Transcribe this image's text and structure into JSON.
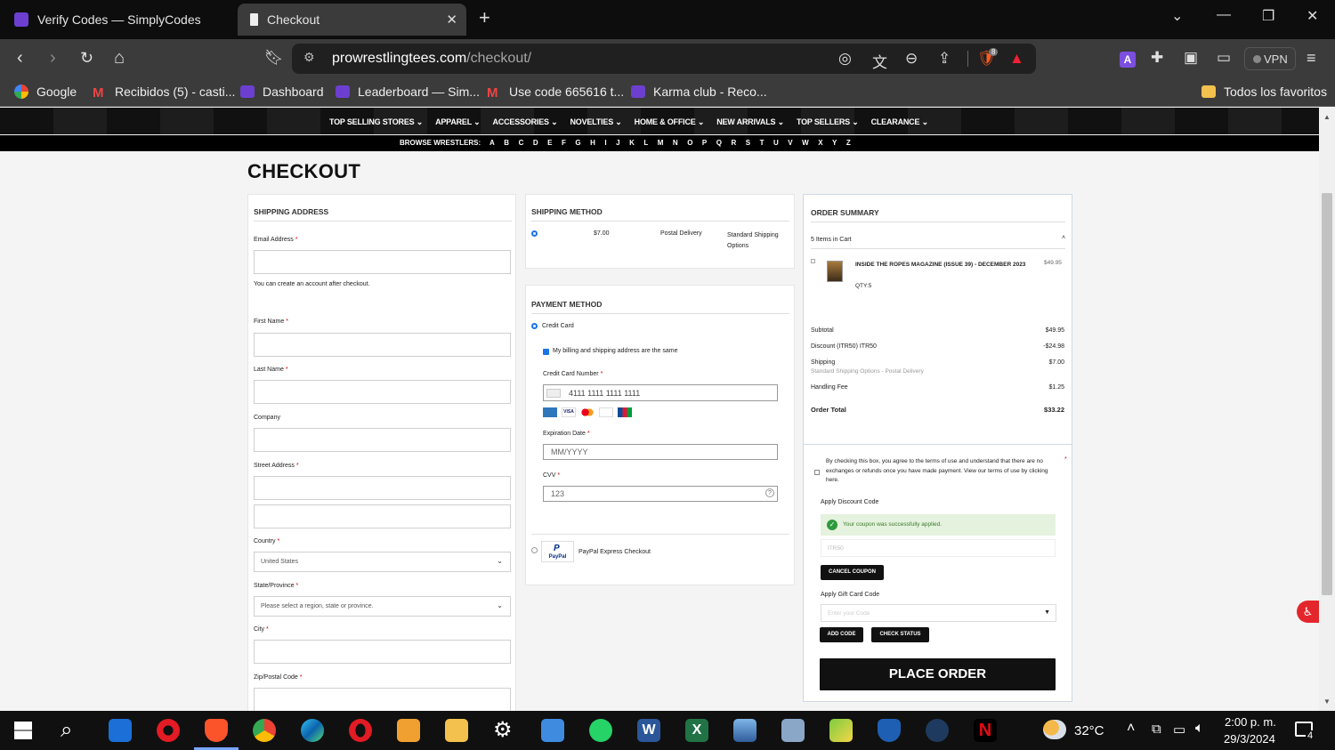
{
  "browser": {
    "tabs": [
      {
        "title": "Verify Codes — SimplyCodes"
      },
      {
        "title": "Checkout"
      }
    ],
    "url_host": "prowrestlingtees.com",
    "url_path": "/checkout/",
    "vpn_label": "VPN",
    "brave_badge": "8",
    "bookmarks": [
      {
        "label": "Google"
      },
      {
        "label": "Recibidos (5) - casti..."
      },
      {
        "label": "Dashboard"
      },
      {
        "label": "Leaderboard — Sim..."
      },
      {
        "label": "Use code 665616 t..."
      },
      {
        "label": "Karma club - Reco..."
      }
    ],
    "all_favorites": "Todos los favoritos"
  },
  "site_nav": {
    "menu": [
      "TOP SELLING STORES ⌄",
      "APPAREL ⌄",
      "ACCESSORIES ⌄",
      "NOVELTIES ⌄",
      "HOME & OFFICE ⌄",
      "NEW ARRIVALS ⌄",
      "TOP SELLERS ⌄",
      "CLEARANCE ⌄"
    ],
    "browse_label": "BROWSE WRESTLERS:",
    "letters": [
      "A",
      "B",
      "C",
      "D",
      "E",
      "F",
      "G",
      "H",
      "I",
      "J",
      "K",
      "L",
      "M",
      "N",
      "O",
      "P",
      "Q",
      "R",
      "S",
      "T",
      "U",
      "V",
      "W",
      "X",
      "Y",
      "Z"
    ]
  },
  "page_title": "CHECKOUT",
  "shipping_address": {
    "title": "SHIPPING ADDRESS",
    "email_label": "Email Address",
    "email_hint": "You can create an account after checkout.",
    "first_name_label": "First Name",
    "last_name_label": "Last Name",
    "company_label": "Company",
    "street_label": "Street Address",
    "country_label": "Country",
    "country_value": "United States",
    "state_label": "State/Province",
    "state_placeholder": "Please select a region, state or province.",
    "city_label": "City",
    "zip_label": "Zip/Postal Code"
  },
  "shipping_method": {
    "title": "SHIPPING METHOD",
    "price": "$7.00",
    "carrier": "Postal Delivery",
    "method": "Standard Shipping Options"
  },
  "payment_method": {
    "title": "PAYMENT METHOD",
    "credit_card_label": "Credit Card",
    "billing_same_label": "My billing and shipping address are the same",
    "cc_number_label": "Credit Card Number",
    "cc_number_value": "4111 1111 1111 1111",
    "card_brands": [
      "AMEX",
      "VISA",
      "MC",
      "DISC",
      "JCB"
    ],
    "expiration_label": "Expiration Date",
    "expiration_placeholder": "MM/YYYY",
    "cvv_label": "CVV",
    "cvv_value": "123",
    "paypal_label": "PayPal Express Checkout",
    "paypal_logo": "PayPal"
  },
  "order_summary": {
    "title": "ORDER SUMMARY",
    "items_in_cart": "5 Items in Cart",
    "item_name": "INSIDE THE ROPES MAGAZINE (ISSUE 39) - DECEMBER 2023",
    "item_price": "$49.95",
    "item_qty": "QTY:5",
    "subtotal_label": "Subtotal",
    "subtotal_value": "$49.95",
    "discount_label": "Discount (ITR50) ITR50",
    "discount_value": "-$24.98",
    "shipping_label": "Shipping",
    "shipping_detail": "Standard Shipping Options - Postal Delivery",
    "shipping_value": "$7.00",
    "handling_label": "Handling Fee",
    "handling_value": "$1.25",
    "total_label": "Order Total",
    "total_value": "$33.22",
    "terms_text": "By checking this box, you agree to the terms of use and understand that there are no exchanges or refunds once you have made payment. View our terms of use by clicking here.",
    "discount_code_label": "Apply Discount Code",
    "coupon_success": "Your coupon was successfully applied.",
    "coupon_value": "ITR50",
    "cancel_coupon": "CANCEL COUPON",
    "gift_card_label": "Apply Gift Card Code",
    "gift_card_placeholder": "Enter your Code",
    "add_code": "ADD CODE",
    "check_status": "CHECK STATUS",
    "place_order": "PLACE ORDER"
  },
  "taskbar": {
    "weather": "32°C",
    "time": "2:00 p. m.",
    "date": "29/3/2024",
    "notif_count": "4"
  }
}
